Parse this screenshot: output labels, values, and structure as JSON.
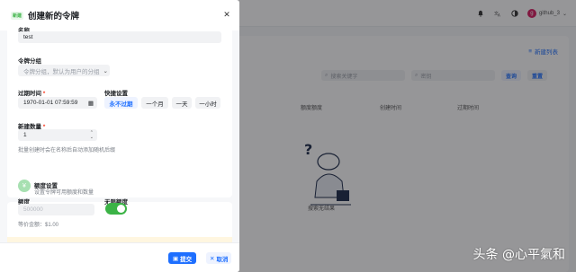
{
  "background": {
    "user_name": "github_3",
    "avatar_letter": "g",
    "add_token_label": "新建列表",
    "search_placeholder": "搜索关键字",
    "search2_placeholder": "密钥",
    "query_label": "查询",
    "reset_label": "重置",
    "columns": [
      "额度额度",
      "创建时间",
      "过期时间"
    ],
    "empty_text": "搜索无结果"
  },
  "sheet": {
    "badge": "新建",
    "title": "创建新的令牌",
    "name_label": "名称",
    "name_value": "test",
    "group_label": "令牌分组",
    "group_placeholder": "令牌分组，默认为用户的分组",
    "expire_label": "过期时间",
    "expire_value": "1970-01-01 07:59:59",
    "quick_label": "快捷设置",
    "quick_options": [
      "永不过期",
      "一个月",
      "一天",
      "一小时"
    ],
    "count_label": "新建数量",
    "count_value": "1",
    "count_hint": "批量创建时会在名称后自动添加随机后缀",
    "quota_title": "额度设置",
    "quota_subtitle": "设置令牌可用额度和数量",
    "quota_label": "额度",
    "quota_placeholder": "500000",
    "unlimited_label": "无限额度",
    "equivalent": "等价金额：$1.00",
    "submit_label": "提交",
    "cancel_label": "取消"
  },
  "watermark": "头条 @心平氣和",
  "colors": {
    "primary": "#1e6fff",
    "success": "#3bb346",
    "danger": "#f93920"
  }
}
